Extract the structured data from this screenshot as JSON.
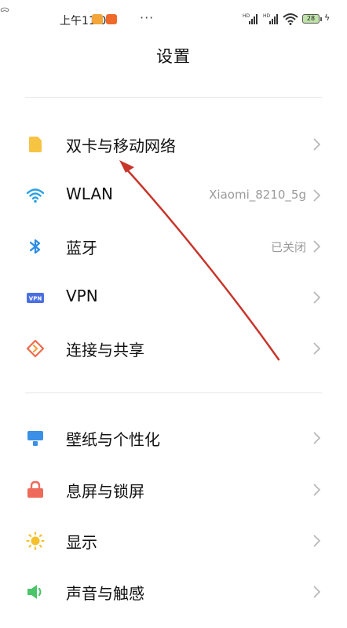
{
  "status_bar": {
    "time": "上午11:04",
    "notif_small": "ᯅ",
    "more": "···",
    "battery_level": "28",
    "signal_label": "HD"
  },
  "page": {
    "title": "设置"
  },
  "groups": [
    {
      "items": [
        {
          "label": "双卡与移动网络",
          "value": "",
          "icon": "sim-card-icon",
          "color": "#f6c343"
        },
        {
          "label": "WLAN",
          "value": "Xiaomi_8210_5g",
          "icon": "wifi-icon",
          "color": "#2aa0e6"
        },
        {
          "label": "蓝牙",
          "value": "已关闭",
          "icon": "bluetooth-icon",
          "color": "#2a8de6"
        },
        {
          "label": "VPN",
          "value": "",
          "icon": "vpn-icon",
          "color": "#4b6fe0"
        },
        {
          "label": "连接与共享",
          "value": "",
          "icon": "connection-share-icon",
          "color": "#ee6a4a"
        }
      ]
    },
    {
      "items": [
        {
          "label": "壁纸与个性化",
          "value": "",
          "icon": "wallpaper-icon",
          "color": "#3a8fe6"
        },
        {
          "label": "息屏与锁屏",
          "value": "",
          "icon": "lock-icon",
          "color": "#ee6a5a"
        },
        {
          "label": "显示",
          "value": "",
          "icon": "brightness-icon",
          "color": "#f4c02e"
        },
        {
          "label": "声音与触感",
          "value": "",
          "icon": "sound-icon",
          "color": "#4cc46a"
        }
      ]
    }
  ],
  "annotation": {
    "color": "#c9352b"
  }
}
